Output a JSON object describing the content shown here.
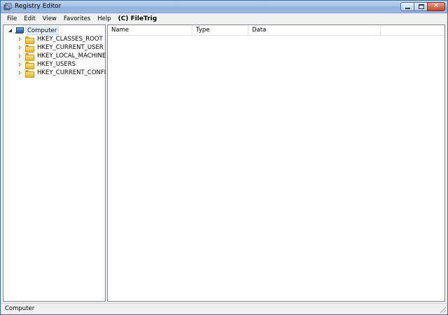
{
  "window": {
    "title": "Registry Editor",
    "icon": "registry-editor-icon",
    "controls": {
      "minimize_icon": "minimize-icon",
      "maximize_icon": "maximize-icon",
      "close_icon": "close-icon",
      "close_glyph": "✕"
    }
  },
  "menu": {
    "items": [
      "File",
      "Edit",
      "View",
      "Favorites",
      "Help"
    ],
    "watermark": "(C) FileTrig"
  },
  "tree": {
    "root": {
      "label": "Computer",
      "icon": "computer-icon",
      "expanded": true,
      "selected": true
    },
    "children": [
      {
        "label": "HKEY_CLASSES_ROOT",
        "icon": "folder-icon",
        "expanded": false
      },
      {
        "label": "HKEY_CURRENT_USER",
        "icon": "folder-icon",
        "expanded": false
      },
      {
        "label": "HKEY_LOCAL_MACHINE",
        "icon": "folder-icon",
        "expanded": false
      },
      {
        "label": "HKEY_USERS",
        "icon": "folder-icon",
        "expanded": false
      },
      {
        "label": "HKEY_CURRENT_CONFIG",
        "icon": "folder-icon",
        "expanded": false
      }
    ]
  },
  "list": {
    "columns": [
      "Name",
      "Type",
      "Data"
    ],
    "rows": []
  },
  "status": {
    "text": "Computer"
  },
  "colors": {
    "titlebar": "#a5c2e6",
    "window_bg": "#f0f0f0",
    "pane_bg": "#ffffff",
    "selection": "#e5f1fb",
    "close_button": "#c6452c"
  }
}
